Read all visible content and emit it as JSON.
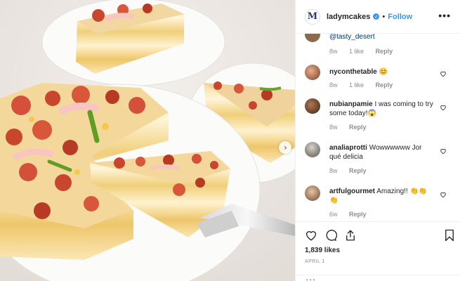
{
  "post": {
    "photo_alt": "layered pizza crepe cake on white plates",
    "next_arrow_glyph": "›"
  },
  "header": {
    "avatar_letter": "M",
    "username": "ladymcakes",
    "verified_glyph": "✓",
    "separator": "•",
    "follow_label": "Follow",
    "more_glyph": "•••"
  },
  "comments": [
    {
      "username": "",
      "text": "@tasty_desert",
      "meta_time": "8w",
      "meta_likes": "1 like",
      "meta_reply": "Reply"
    },
    {
      "username": "nyconthetable",
      "text": "😊",
      "meta_time": "8w",
      "meta_likes": "1 like",
      "meta_reply": "Reply"
    },
    {
      "username": "nubianpamie",
      "text": "I was coming to try some today!😱",
      "meta_time": "8w",
      "meta_likes": "",
      "meta_reply": "Reply"
    },
    {
      "username": "analiaprotti",
      "text": "Wowwwwww Jor qué delicia",
      "meta_time": "8w",
      "meta_likes": "",
      "meta_reply": "Reply"
    },
    {
      "username": "artfulgourmet",
      "text": "Amazing!! 👏👏👏",
      "meta_time": "6w",
      "meta_likes": "",
      "meta_reply": "Reply"
    }
  ],
  "actions": {
    "likes": "1,839 likes",
    "date": "APRIL 1",
    "add_comment_dots": "•••"
  },
  "colors": {
    "accent": "#3897f0",
    "text": "#262626",
    "muted": "#8e8e8e"
  }
}
